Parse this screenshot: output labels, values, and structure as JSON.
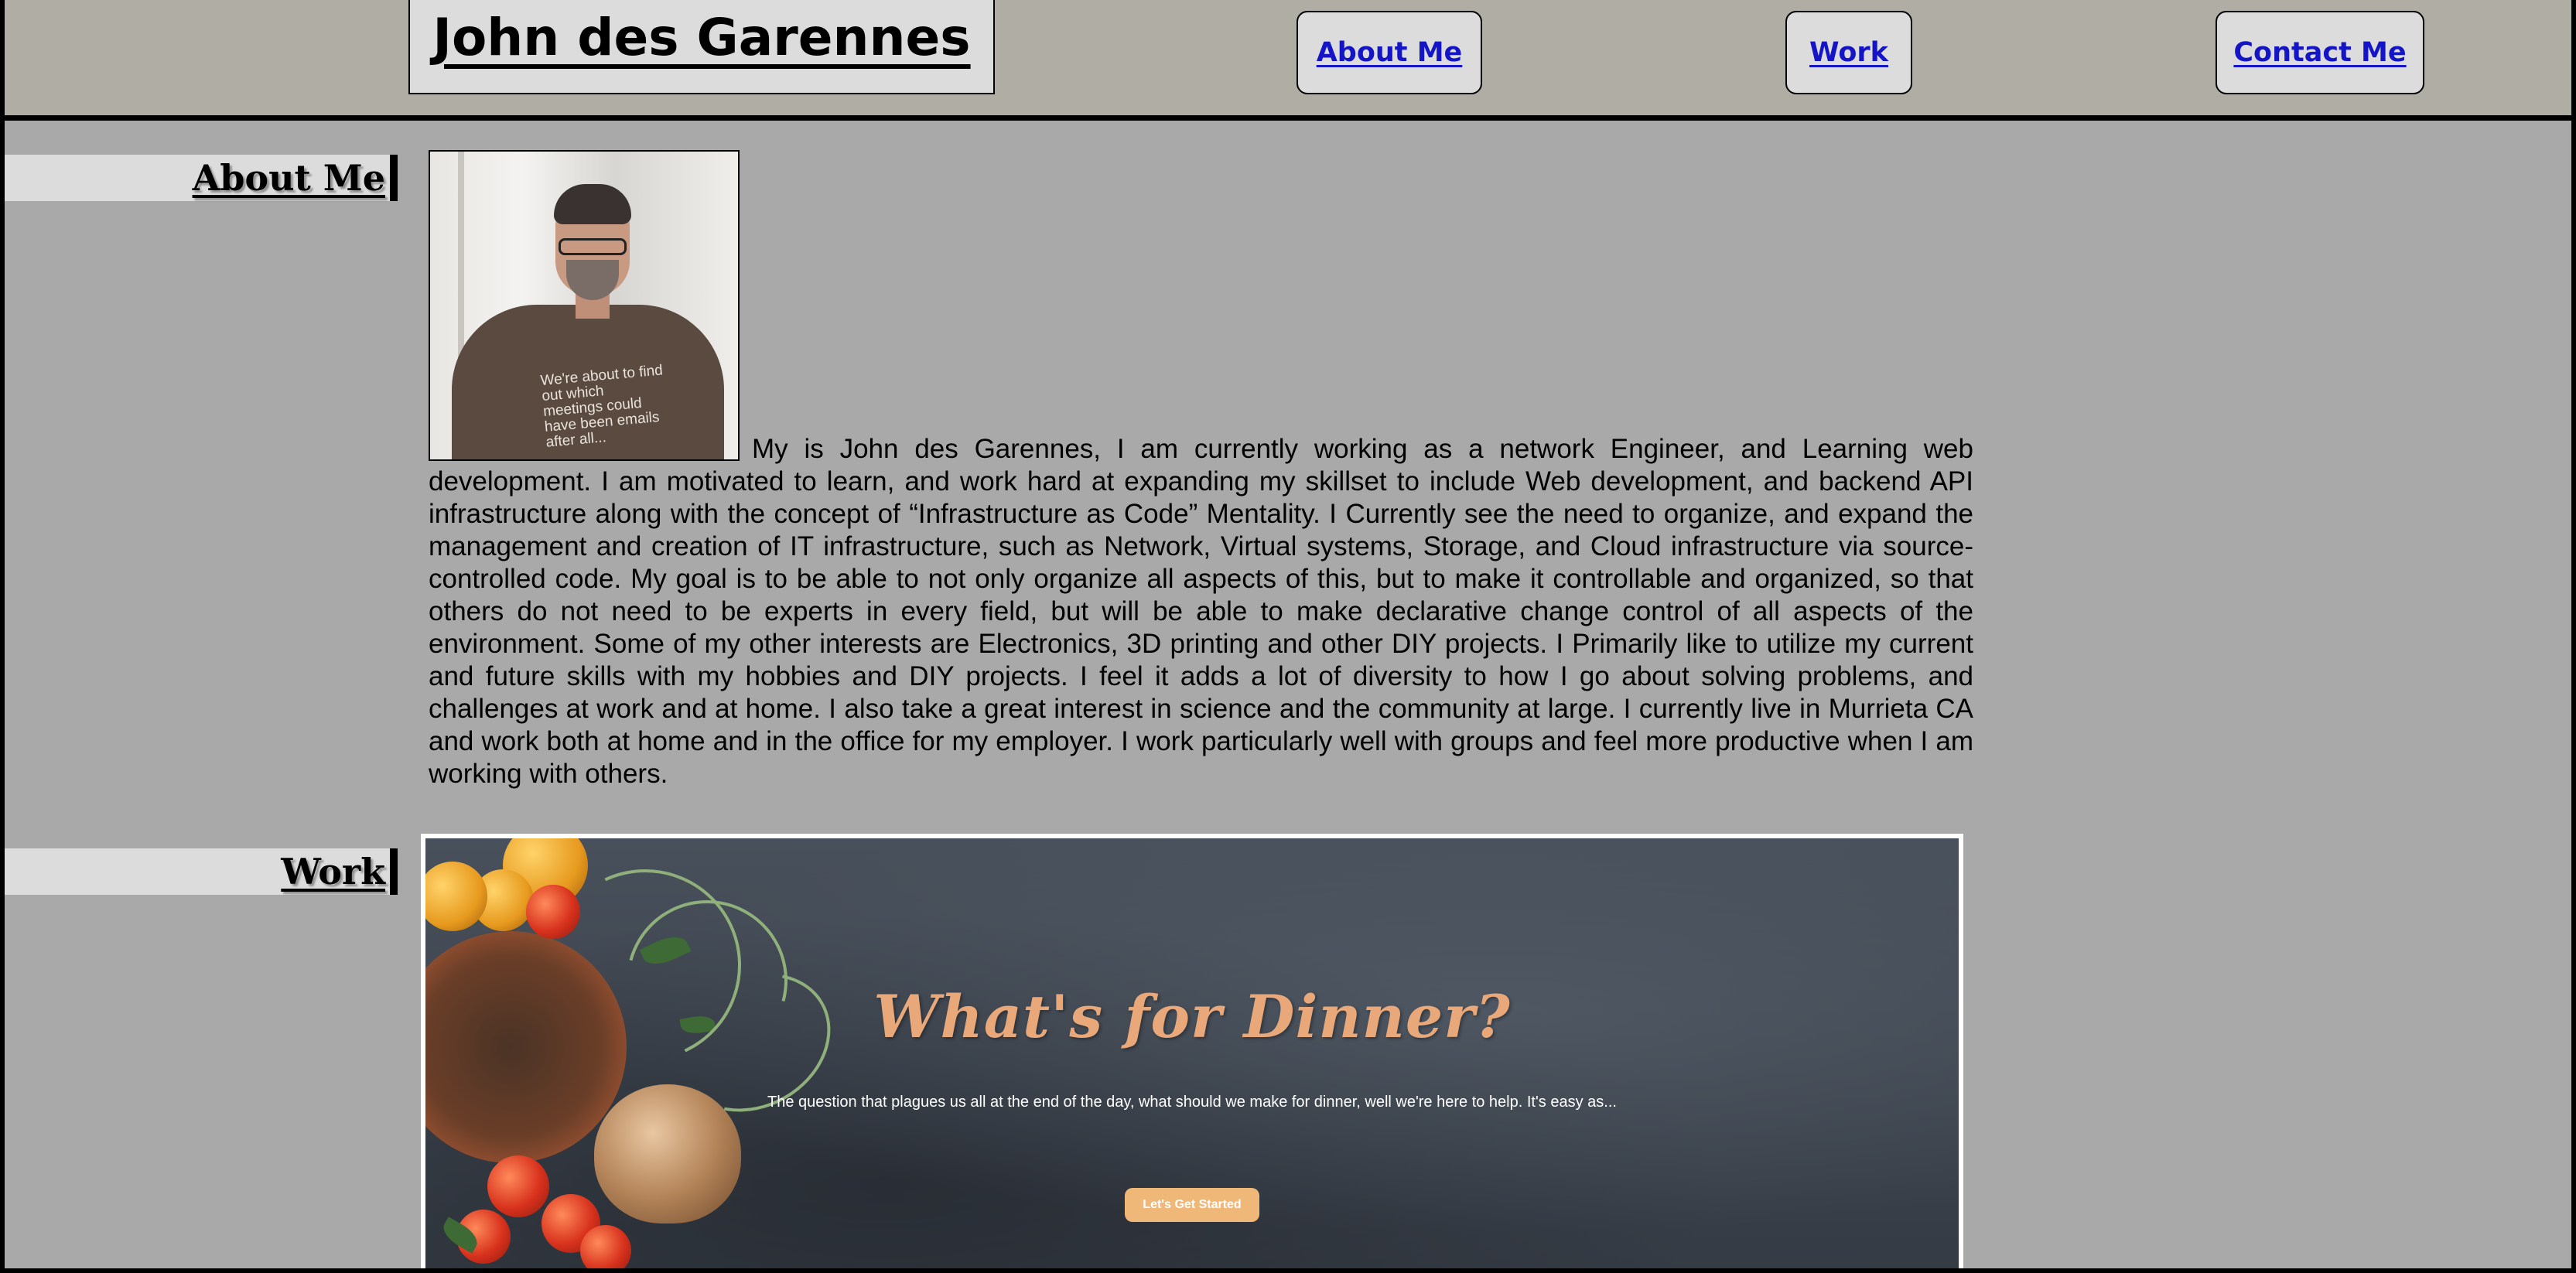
{
  "header": {
    "site_title": "John des Garennes",
    "nav": [
      {
        "label": "About Me"
      },
      {
        "label": "Work"
      },
      {
        "label": "Contact Me"
      }
    ]
  },
  "about": {
    "section_label": "About Me",
    "photo_shirt_text": "We're about to find out which meetings could have been emails after all...",
    "bio": "My is John des Garennes, I am currently working as a network Engineer, and Learning web development. I am motivated to learn, and work hard at expanding my skillset to include Web development, and backend API infrastructure along with the concept of “Infrastructure as Code” Mentality. I Currently see the need to organize, and expand the management and creation of IT infrastructure, such as Network, Virtual systems, Storage, and Cloud infrastructure via source-controlled code. My goal is to be able to not only organize all aspects of this, but to make it controllable and organized, so that others do not need to be experts in every field, but will be able to make declarative change control of all aspects of the environment. Some of my other interests are Electronics, 3D printing and other DIY projects. I Primarily like to utilize my current and future skills with my hobbies and DIY projects. I feel it adds a lot of diversity to how I go about solving problems, and challenges at work and at home. I also take a great interest in science and the community at large. I currently live in Murrieta CA and work both at home and in the office for my employer. I work particularly well with groups and feel more productive when I am working with others."
  },
  "work": {
    "section_label": "Work",
    "project": {
      "title": "What's for Dinner?",
      "tagline": "The question that plagues us all at the end of the day, what should we make for dinner, well we're here to help. It's easy as...",
      "cta_label": "Let's Get Started"
    }
  },
  "colors": {
    "page_background": "#a9a9a9",
    "header_background": "#b0ada5",
    "label_background": "#dcdcdc",
    "nav_link": "#1515c8",
    "project_title": "#e8a87a",
    "project_button": "#f0b878"
  }
}
